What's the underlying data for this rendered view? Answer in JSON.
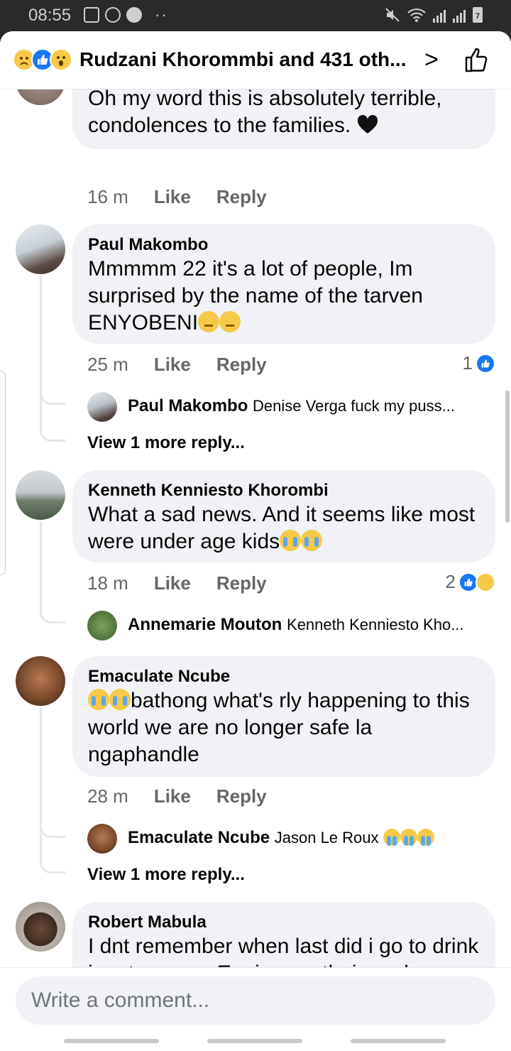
{
  "status": {
    "time": "08:55"
  },
  "header": {
    "title": "Rudzani Khorommbi and 431 oth..."
  },
  "comments": [
    {
      "text": "Oh my word this is absolutely terrible, condolences to the families.",
      "time": "16 m",
      "like": "Like",
      "reply": "Reply"
    },
    {
      "name": "Paul Makombo",
      "text": "Mmmmm 22 it's a lot of people, Im surprised by the name of the tarven ENYOBENI",
      "time": "25 m",
      "like": "Like",
      "reply": "Reply",
      "reactions": "1",
      "reply_preview": {
        "name": "Paul Makombo",
        "text": "Denise Verga fuck my puss..."
      },
      "view_more": "View 1 more reply..."
    },
    {
      "name": "Kenneth Kenniesto Khorombi",
      "text": "What a sad news. And it seems like most were under age kids",
      "time": "18 m",
      "like": "Like",
      "reply": "Reply",
      "reactions": "2",
      "reply_preview": {
        "name": "Annemarie Mouton",
        "text": "Kenneth Kenniesto Kho..."
      }
    },
    {
      "name": "Emaculate Ncube",
      "text": "bathong what's rly happening to this world we are no longer safe la ngaphandle",
      "time": "28 m",
      "like": "Like",
      "reply": "Reply",
      "reply_preview": {
        "name": "Emaculate Ncube",
        "text": "Jason Le Roux"
      },
      "view_more": "View 1 more reply..."
    },
    {
      "name": "Robert Mabula",
      "text": "I dnt remember when last did i go to drink in a tavern.....Eeeix may their soul"
    }
  ],
  "composer": {
    "placeholder": "Write a comment..."
  }
}
